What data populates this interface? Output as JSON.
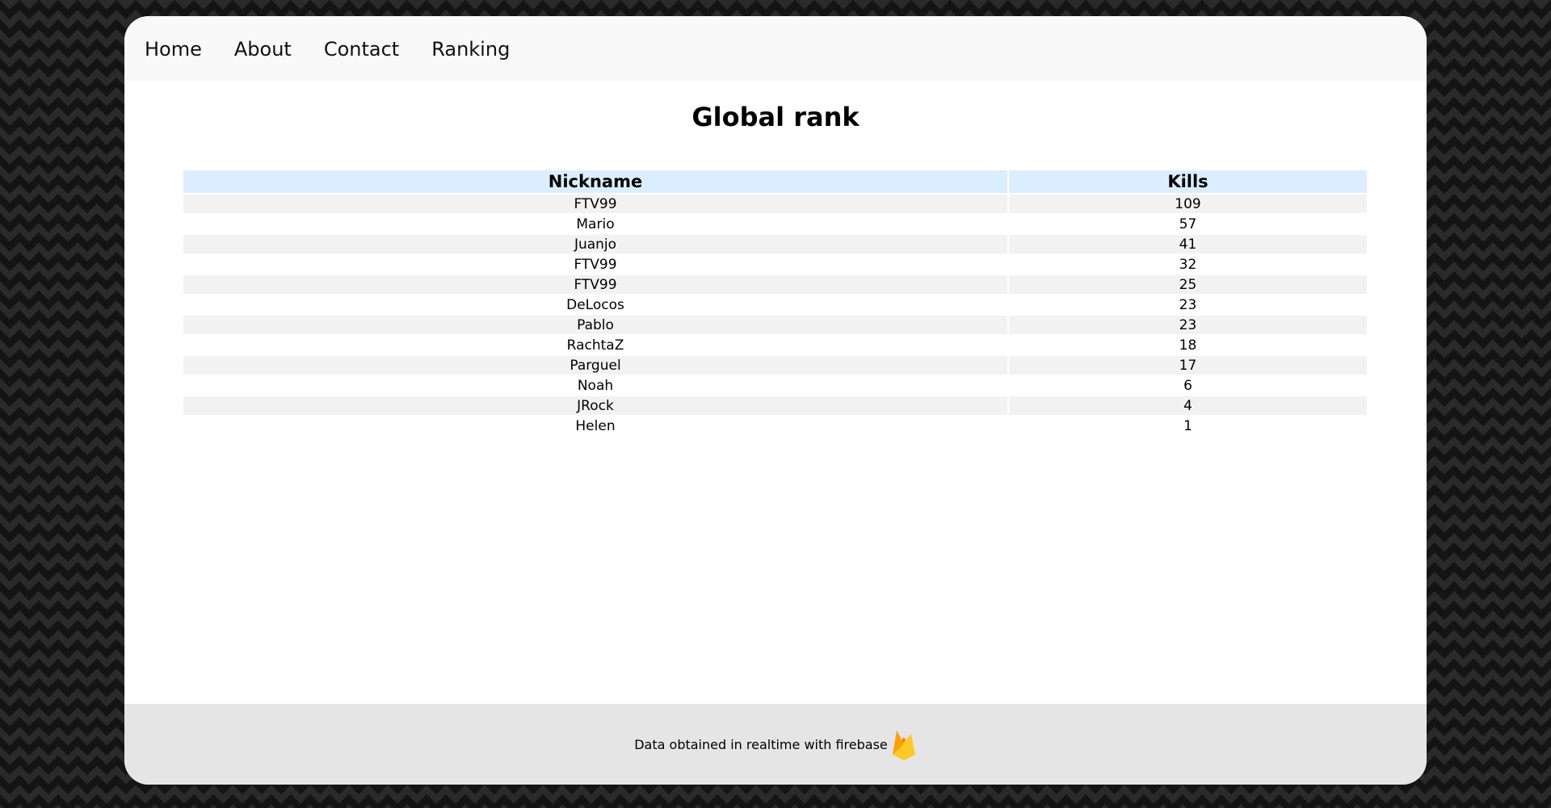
{
  "nav": {
    "items": [
      "Home",
      "About",
      "Contact",
      "Ranking"
    ]
  },
  "page": {
    "title": "Global rank"
  },
  "table": {
    "headers": {
      "nickname": "Nickname",
      "kills": "Kills"
    },
    "rows": [
      {
        "nickname": "FTV99",
        "kills": "109"
      },
      {
        "nickname": "Mario",
        "kills": "57"
      },
      {
        "nickname": "Juanjo",
        "kills": "41"
      },
      {
        "nickname": "FTV99",
        "kills": "32"
      },
      {
        "nickname": "FTV99",
        "kills": "25"
      },
      {
        "nickname": "DeLocos",
        "kills": "23"
      },
      {
        "nickname": "Pablo",
        "kills": "23"
      },
      {
        "nickname": "RachtaZ",
        "kills": "18"
      },
      {
        "nickname": "Parguel",
        "kills": "17"
      },
      {
        "nickname": "Noah",
        "kills": "6"
      },
      {
        "nickname": "JRock",
        "kills": "4"
      },
      {
        "nickname": "Helen",
        "kills": "1"
      }
    ]
  },
  "footer": {
    "text": "Data obtained in realtime with firebase",
    "icon": "firebase-icon"
  },
  "colors": {
    "header_row": "#dbeeff",
    "striped_row": "#f2f2f2",
    "footer_bg": "#e5e5e5",
    "nav_bg": "#f9f9f9"
  }
}
